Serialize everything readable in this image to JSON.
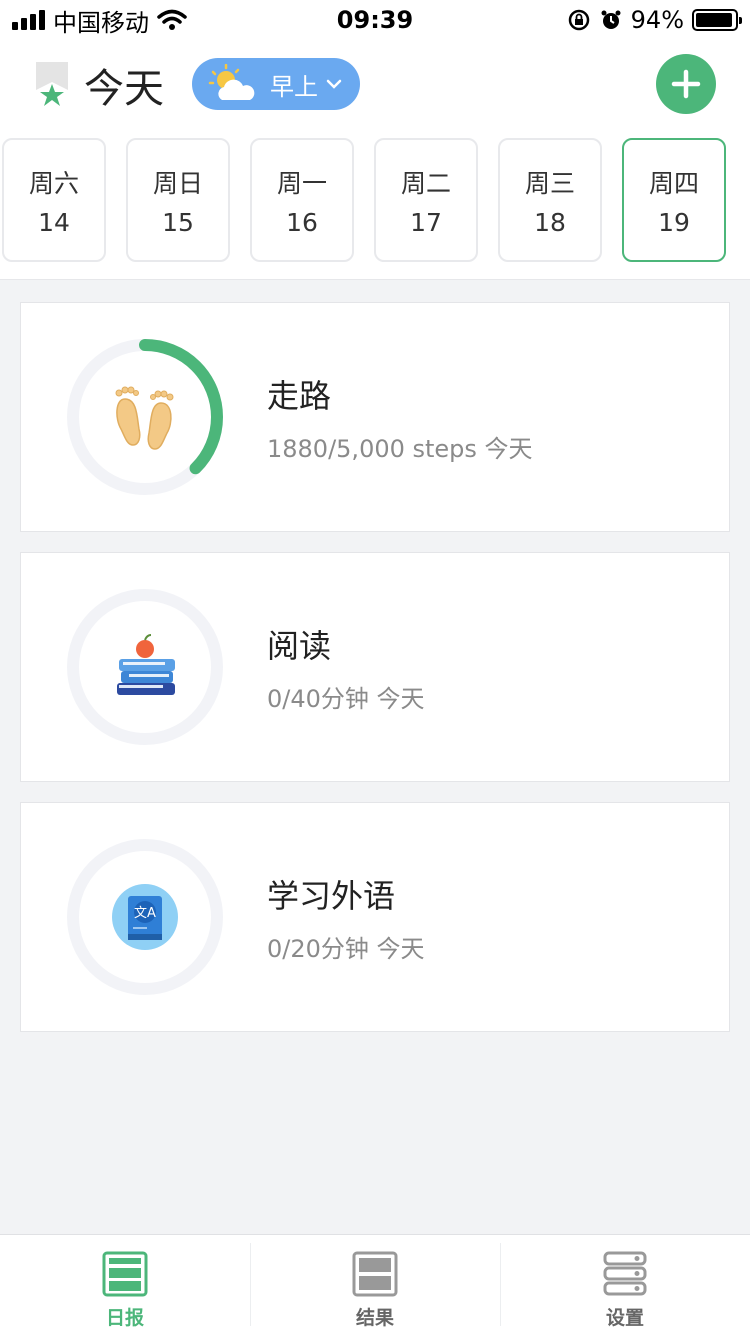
{
  "status_bar": {
    "carrier": "中国移动",
    "time": "09:39",
    "battery": "94%",
    "battery_level": 0.94
  },
  "header": {
    "title": "今天",
    "period": "早上",
    "icons": {
      "logo": "star-icon",
      "weather": "sun-cloud-icon",
      "add": "plus-icon"
    }
  },
  "days": [
    {
      "name": "周六",
      "date": "14",
      "active": false
    },
    {
      "name": "周日",
      "date": "15",
      "active": false
    },
    {
      "name": "周一",
      "date": "16",
      "active": false
    },
    {
      "name": "周二",
      "date": "17",
      "active": false
    },
    {
      "name": "周三",
      "date": "18",
      "active": false
    },
    {
      "name": "周四",
      "date": "19",
      "active": true
    }
  ],
  "habits": [
    {
      "title": "走路",
      "subtitle": "1880/5,000 steps 今天",
      "progress": 0.376,
      "icon": "footprints-icon"
    },
    {
      "title": "阅读",
      "subtitle": "0/40分钟 今天",
      "progress": 0,
      "icon": "books-apple-icon"
    },
    {
      "title": "学习外语",
      "subtitle": "0/20分钟 今天",
      "progress": 0,
      "icon": "translate-book-icon"
    }
  ],
  "tabs": [
    {
      "label": "日报",
      "icon": "daily-report-icon",
      "active": true
    },
    {
      "label": "结果",
      "icon": "results-icon",
      "active": false
    },
    {
      "label": "设置",
      "icon": "settings-icon",
      "active": false
    }
  ],
  "colors": {
    "accent": "#4cb67a",
    "pill": "#6aa9f0",
    "ring_track": "#f2f3f7",
    "background": "#f2f3f5"
  }
}
